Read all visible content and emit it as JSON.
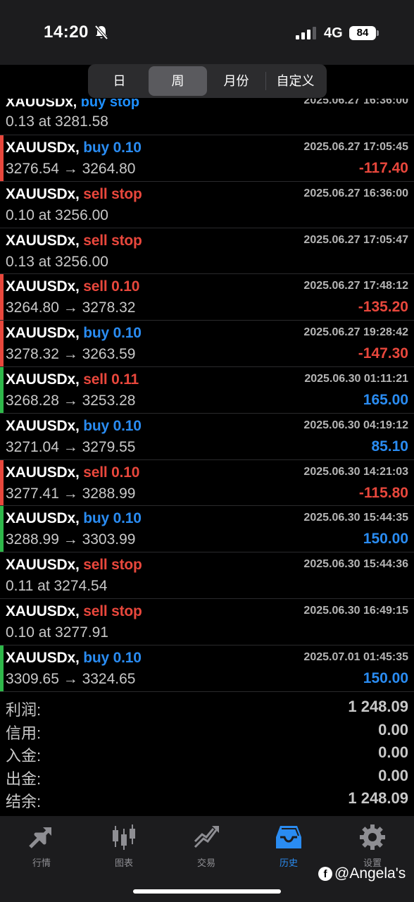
{
  "status_bar": {
    "time": "14:20",
    "network": "4G",
    "battery": "84"
  },
  "period_tabs": [
    "日",
    "周",
    "月份",
    "自定义"
  ],
  "partial_row": {
    "symbol": "XAUUSDx,",
    "side": "buy stop",
    "detail": "0.13 at 3281.58",
    "time": "2025.06.27 16:36:00"
  },
  "trades": [
    {
      "symbol": "XAUUSDx,",
      "side": "buy 0.10",
      "side_type": "buy",
      "time": "2025.06.27 17:05:45",
      "detail": "3276.54 → 3264.80",
      "profit": "-117.40",
      "profit_type": "neg",
      "marker": "red"
    },
    {
      "symbol": "XAUUSDx,",
      "side": "sell stop",
      "side_type": "sell",
      "time": "2025.06.27 16:36:00",
      "detail": "0.10 at 3256.00",
      "profit": "",
      "profit_type": "",
      "marker": ""
    },
    {
      "symbol": "XAUUSDx,",
      "side": "sell stop",
      "side_type": "sell",
      "time": "2025.06.27 17:05:47",
      "detail": "0.13 at 3256.00",
      "profit": "",
      "profit_type": "",
      "marker": ""
    },
    {
      "symbol": "XAUUSDx,",
      "side": "sell 0.10",
      "side_type": "sell",
      "time": "2025.06.27 17:48:12",
      "detail": "3264.80 → 3278.32",
      "profit": "-135.20",
      "profit_type": "neg",
      "marker": "red"
    },
    {
      "symbol": "XAUUSDx,",
      "side": "buy 0.10",
      "side_type": "buy",
      "time": "2025.06.27 19:28:42",
      "detail": "3278.32 → 3263.59",
      "profit": "-147.30",
      "profit_type": "neg",
      "marker": "red"
    },
    {
      "symbol": "XAUUSDx,",
      "side": "sell 0.11",
      "side_type": "sell",
      "time": "2025.06.30 01:11:21",
      "detail": "3268.28 → 3253.28",
      "profit": "165.00",
      "profit_type": "pos",
      "marker": "green"
    },
    {
      "symbol": "XAUUSDx,",
      "side": "buy 0.10",
      "side_type": "buy",
      "time": "2025.06.30 04:19:12",
      "detail": "3271.04 → 3279.55",
      "profit": "85.10",
      "profit_type": "pos",
      "marker": ""
    },
    {
      "symbol": "XAUUSDx,",
      "side": "sell 0.10",
      "side_type": "sell",
      "time": "2025.06.30 14:21:03",
      "detail": "3277.41 → 3288.99",
      "profit": "-115.80",
      "profit_type": "neg",
      "marker": "red"
    },
    {
      "symbol": "XAUUSDx,",
      "side": "buy 0.10",
      "side_type": "buy",
      "time": "2025.06.30 15:44:35",
      "detail": "3288.99 → 3303.99",
      "profit": "150.00",
      "profit_type": "pos",
      "marker": "green"
    },
    {
      "symbol": "XAUUSDx,",
      "side": "sell stop",
      "side_type": "sell",
      "time": "2025.06.30 15:44:36",
      "detail": "0.11 at 3274.54",
      "profit": "",
      "profit_type": "",
      "marker": ""
    },
    {
      "symbol": "XAUUSDx,",
      "side": "sell stop",
      "side_type": "sell",
      "time": "2025.06.30 16:49:15",
      "detail": "0.10 at 3277.91",
      "profit": "",
      "profit_type": "",
      "marker": ""
    },
    {
      "symbol": "XAUUSDx,",
      "side": "buy 0.10",
      "side_type": "buy",
      "time": "2025.07.01 01:45:35",
      "detail": "3309.65 → 3324.65",
      "profit": "150.00",
      "profit_type": "pos",
      "marker": "green"
    }
  ],
  "summary": [
    {
      "label": "利润:",
      "value": "1 248.09"
    },
    {
      "label": "信用:",
      "value": "0.00"
    },
    {
      "label": "入金:",
      "value": "0.00"
    },
    {
      "label": "出金:",
      "value": "0.00"
    },
    {
      "label": "结余:",
      "value": "1 248.09"
    }
  ],
  "tab_bar": [
    {
      "label": "行情",
      "icon": "quotes-icon"
    },
    {
      "label": "图表",
      "icon": "chart-icon"
    },
    {
      "label": "交易",
      "icon": "trade-icon"
    },
    {
      "label": "历史",
      "icon": "history-icon",
      "active": true
    },
    {
      "label": "设置",
      "icon": "settings-icon"
    }
  ],
  "watermark": "@Angela's",
  "colors": {
    "buy": "#2a8cf2",
    "sell": "#e8473c",
    "marker_red": "#e8473c",
    "marker_green": "#2fb84a"
  }
}
